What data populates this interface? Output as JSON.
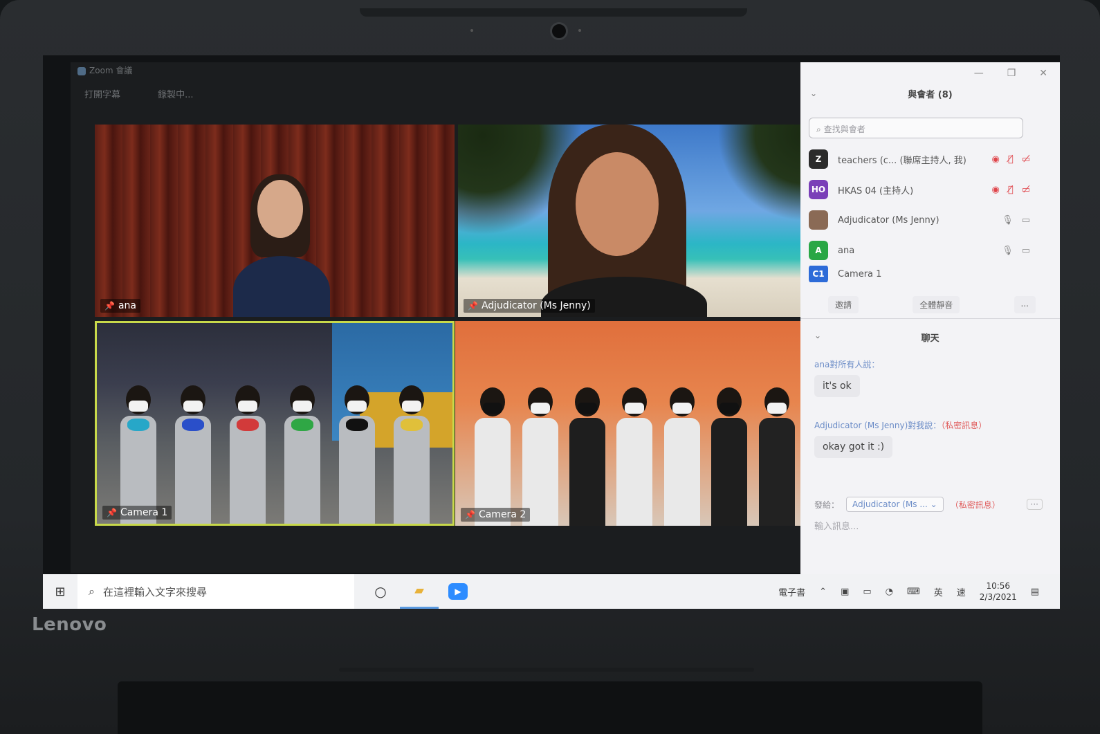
{
  "laptop": {
    "brand": "Lenovo"
  },
  "zoom": {
    "window_title": "Zoom 會議",
    "topbar": [
      "打開字幕",
      "錄製中..."
    ],
    "tiles": [
      {
        "name": "ana"
      },
      {
        "name": "Adjudicator (Ms Jenny)"
      },
      {
        "name": "Camera 1"
      },
      {
        "name": "Camera 2"
      }
    ]
  },
  "panel": {
    "window_controls": [
      "—",
      "❐",
      "✕"
    ],
    "participants_title": "與會者 (8)",
    "search_placeholder": "查找與會者",
    "participants": [
      {
        "initials": "Z",
        "name": "teachers (c... (聯席主持人, 我)",
        "avatar_color": "#2b2b2b"
      },
      {
        "initials": "HO",
        "name": "HKAS 04 (主持人)",
        "avatar_color": "#7a3fb8"
      },
      {
        "initials": "",
        "name": "Adjudicator (Ms Jenny)",
        "avatar_color": "#8a6a55"
      },
      {
        "initials": "A",
        "name": "ana",
        "avatar_color": "#29a745"
      },
      {
        "initials": "C1",
        "name": "Camera 1",
        "avatar_color": "#2d6bd8"
      }
    ],
    "actions": {
      "invite": "邀請",
      "mute_all": "全體靜音",
      "more": "..."
    },
    "chat_title": "聊天",
    "messages": [
      {
        "from": "ana對所有人說：",
        "private": "",
        "text": "it's ok"
      },
      {
        "from": "Adjudicator (Ms Jenny)對我說：",
        "private": "（私密訊息）",
        "text": "okay got it :)"
      }
    ],
    "send_to_label": "發給：",
    "send_to_value": "Adjudicator (Ms ... ⌄",
    "send_private": "（私密訊息）",
    "send_more": "···",
    "input_placeholder": "輸入訊息..."
  },
  "taskbar": {
    "search_placeholder": "在這裡輸入文字來搜尋",
    "tray_ebook": "電子書",
    "tray_lang": "英",
    "tray_speed": "速",
    "time": "10:56",
    "date": "2/3/2021"
  }
}
